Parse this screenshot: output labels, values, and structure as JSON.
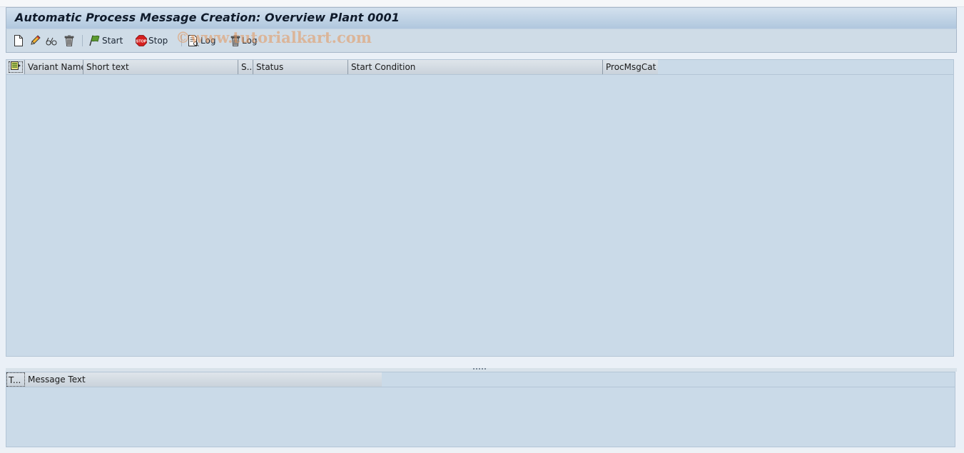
{
  "window": {
    "title": "Automatic Process Message Creation: Overview Plant 0001"
  },
  "toolbar": {
    "items": [
      {
        "id": "create",
        "icon": "new-document-icon",
        "label": ""
      },
      {
        "id": "change",
        "icon": "pencil-icon",
        "label": ""
      },
      {
        "id": "display",
        "icon": "glasses-icon",
        "label": ""
      },
      {
        "id": "delete",
        "icon": "trash-icon",
        "label": ""
      },
      {
        "id": "start",
        "icon": "green-flag-icon",
        "label": "Start"
      },
      {
        "id": "stop",
        "icon": "stop-sign-icon",
        "label": "Stop"
      },
      {
        "id": "log_display",
        "icon": "log-document-icon",
        "label": "Log"
      },
      {
        "id": "log_delete",
        "icon": "trash-icon",
        "label": "Log"
      }
    ]
  },
  "watermark": "©www.tutorialkart.com",
  "variants_grid": {
    "columns": [
      "Variant Name",
      "Short text",
      "S...",
      "Status",
      "Start Condition",
      "ProcMsgCat"
    ],
    "rows": []
  },
  "messages_grid": {
    "columns": [
      "T...",
      "Message Text"
    ],
    "rows": []
  },
  "colors": {
    "title_gradient_top": "#d3e1ee",
    "title_gradient_bottom": "#b0c7de",
    "toolbar_bg": "#cfdce7",
    "grid_bg": "#cadae8",
    "page_bg": "#eaf0f7"
  }
}
